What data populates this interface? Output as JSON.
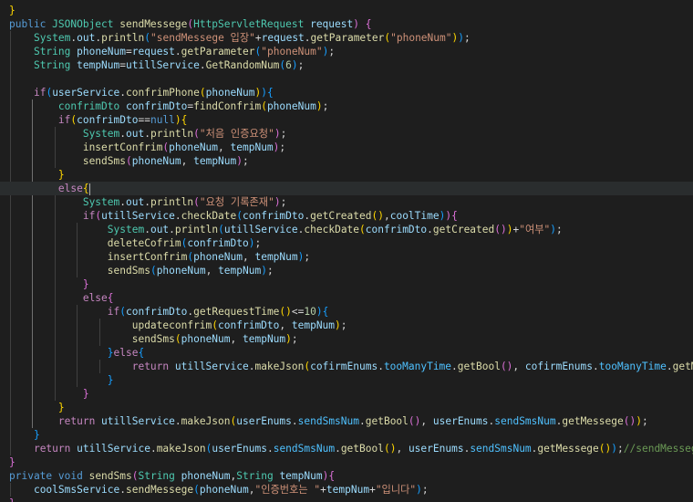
{
  "editor": {
    "language": "java",
    "theme": "dark",
    "current_line": 13,
    "lines": [
      [
        [
          "br1",
          "}"
        ]
      ],
      [
        [
          "kw",
          "public "
        ],
        [
          "typ",
          "JSONObject "
        ],
        [
          "fn",
          "sendMessege"
        ],
        [
          "br2",
          "("
        ],
        [
          "typ",
          "HttpServletRequest "
        ],
        [
          "var",
          "request"
        ],
        [
          "br2",
          ")"
        ],
        [
          "pun",
          " "
        ],
        [
          "br2",
          "{"
        ]
      ],
      [
        [
          "pun",
          "    "
        ],
        [
          "typ",
          "System"
        ],
        [
          "pun",
          "."
        ],
        [
          "var",
          "out"
        ],
        [
          "pun",
          "."
        ],
        [
          "fn",
          "println"
        ],
        [
          "br3",
          "("
        ],
        [
          "str",
          "\"sendMessege 입장\""
        ],
        [
          "pun",
          "+"
        ],
        [
          "var",
          "request"
        ],
        [
          "pun",
          "."
        ],
        [
          "fn",
          "getParameter"
        ],
        [
          "br1",
          "("
        ],
        [
          "str",
          "\"phoneNum\""
        ],
        [
          "br1",
          ")"
        ],
        [
          "br3",
          ")"
        ],
        [
          "pun",
          ";"
        ]
      ],
      [
        [
          "pun",
          "    "
        ],
        [
          "typ",
          "String "
        ],
        [
          "var",
          "phoneNum"
        ],
        [
          "pun",
          "="
        ],
        [
          "var",
          "request"
        ],
        [
          "pun",
          "."
        ],
        [
          "fn",
          "getParameter"
        ],
        [
          "br3",
          "("
        ],
        [
          "str",
          "\"phoneNum\""
        ],
        [
          "br3",
          ")"
        ],
        [
          "pun",
          ";"
        ]
      ],
      [
        [
          "pun",
          "    "
        ],
        [
          "typ",
          "String "
        ],
        [
          "var",
          "tempNum"
        ],
        [
          "pun",
          "="
        ],
        [
          "var",
          "utillService"
        ],
        [
          "pun",
          "."
        ],
        [
          "fn",
          "GetRandomNum"
        ],
        [
          "br3",
          "("
        ],
        [
          "num",
          "6"
        ],
        [
          "br3",
          ")"
        ],
        [
          "pun",
          ";"
        ]
      ],
      [],
      [
        [
          "pun",
          "    "
        ],
        [
          "ctl",
          "if"
        ],
        [
          "br3",
          "("
        ],
        [
          "var",
          "userService"
        ],
        [
          "pun",
          "."
        ],
        [
          "fn",
          "confrimPhone"
        ],
        [
          "br1",
          "("
        ],
        [
          "var",
          "phoneNum"
        ],
        [
          "br1",
          ")"
        ],
        [
          "br3",
          ")"
        ],
        [
          "br3",
          "{"
        ]
      ],
      [
        [
          "pun",
          "        "
        ],
        [
          "typ",
          "confrimDto "
        ],
        [
          "var",
          "confrimDto"
        ],
        [
          "pun",
          "="
        ],
        [
          "fn",
          "findConfrim"
        ],
        [
          "br1",
          "("
        ],
        [
          "var",
          "phoneNum"
        ],
        [
          "br1",
          ")"
        ],
        [
          "pun",
          ";"
        ]
      ],
      [
        [
          "pun",
          "        "
        ],
        [
          "ctl",
          "if"
        ],
        [
          "br1",
          "("
        ],
        [
          "var",
          "confrimDto"
        ],
        [
          "pun",
          "=="
        ],
        [
          "kw",
          "null"
        ],
        [
          "br1",
          ")"
        ],
        [
          "br1",
          "{"
        ]
      ],
      [
        [
          "pun",
          "            "
        ],
        [
          "typ",
          "System"
        ],
        [
          "pun",
          "."
        ],
        [
          "var",
          "out"
        ],
        [
          "pun",
          "."
        ],
        [
          "fn",
          "println"
        ],
        [
          "br2",
          "("
        ],
        [
          "str",
          "\"처음 인증요청\""
        ],
        [
          "br2",
          ")"
        ],
        [
          "pun",
          ";"
        ]
      ],
      [
        [
          "pun",
          "            "
        ],
        [
          "fn",
          "insertConfrim"
        ],
        [
          "br2",
          "("
        ],
        [
          "var",
          "phoneNum"
        ],
        [
          "pun",
          ", "
        ],
        [
          "var",
          "tempNum"
        ],
        [
          "br2",
          ")"
        ],
        [
          "pun",
          ";"
        ]
      ],
      [
        [
          "pun",
          "            "
        ],
        [
          "fn",
          "sendSms"
        ],
        [
          "br2",
          "("
        ],
        [
          "var",
          "phoneNum"
        ],
        [
          "pun",
          ", "
        ],
        [
          "var",
          "tempNum"
        ],
        [
          "br2",
          ")"
        ],
        [
          "pun",
          ";"
        ]
      ],
      [
        [
          "pun",
          "        "
        ],
        [
          "br1",
          "}"
        ]
      ],
      [
        [
          "pun",
          "        "
        ],
        [
          "ctl",
          "else"
        ],
        [
          "br1",
          "{"
        ]
      ],
      [
        [
          "pun",
          "            "
        ],
        [
          "typ",
          "System"
        ],
        [
          "pun",
          "."
        ],
        [
          "var",
          "out"
        ],
        [
          "pun",
          "."
        ],
        [
          "fn",
          "println"
        ],
        [
          "br2",
          "("
        ],
        [
          "str",
          "\"요청 기록존재\""
        ],
        [
          "br2",
          ")"
        ],
        [
          "pun",
          ";"
        ]
      ],
      [
        [
          "pun",
          "            "
        ],
        [
          "ctl",
          "if"
        ],
        [
          "br2",
          "("
        ],
        [
          "var",
          "utillService"
        ],
        [
          "pun",
          "."
        ],
        [
          "fn",
          "checkDate"
        ],
        [
          "br3",
          "("
        ],
        [
          "var",
          "confrimDto"
        ],
        [
          "pun",
          "."
        ],
        [
          "fn",
          "getCreated"
        ],
        [
          "br1",
          "()"
        ],
        [
          "pun",
          ","
        ],
        [
          "var",
          "coolTime"
        ],
        [
          "br3",
          ")"
        ],
        [
          "br2",
          ")"
        ],
        [
          "br2",
          "{"
        ]
      ],
      [
        [
          "pun",
          "                "
        ],
        [
          "typ",
          "System"
        ],
        [
          "pun",
          "."
        ],
        [
          "var",
          "out"
        ],
        [
          "pun",
          "."
        ],
        [
          "fn",
          "println"
        ],
        [
          "br3",
          "("
        ],
        [
          "var",
          "utillService"
        ],
        [
          "pun",
          "."
        ],
        [
          "fn",
          "checkDate"
        ],
        [
          "br1",
          "("
        ],
        [
          "var",
          "confrimDto"
        ],
        [
          "pun",
          "."
        ],
        [
          "fn",
          "getCreated"
        ],
        [
          "br2",
          "()"
        ],
        [
          "br1",
          ")"
        ],
        [
          "pun",
          "+"
        ],
        [
          "str",
          "\"여부\""
        ],
        [
          "br3",
          ")"
        ],
        [
          "pun",
          ";"
        ]
      ],
      [
        [
          "pun",
          "                "
        ],
        [
          "fn",
          "deleteCofrim"
        ],
        [
          "br3",
          "("
        ],
        [
          "var",
          "confrimDto"
        ],
        [
          "br3",
          ")"
        ],
        [
          "pun",
          ";"
        ]
      ],
      [
        [
          "pun",
          "                "
        ],
        [
          "fn",
          "insertConfrim"
        ],
        [
          "br3",
          "("
        ],
        [
          "var",
          "phoneNum"
        ],
        [
          "pun",
          ", "
        ],
        [
          "var",
          "tempNum"
        ],
        [
          "br3",
          ")"
        ],
        [
          "pun",
          ";"
        ]
      ],
      [
        [
          "pun",
          "                "
        ],
        [
          "fn",
          "sendSms"
        ],
        [
          "br3",
          "("
        ],
        [
          "var",
          "phoneNum"
        ],
        [
          "pun",
          ", "
        ],
        [
          "var",
          "tempNum"
        ],
        [
          "br3",
          ")"
        ],
        [
          "pun",
          ";"
        ]
      ],
      [
        [
          "pun",
          "            "
        ],
        [
          "br2",
          "}"
        ]
      ],
      [
        [
          "pun",
          "            "
        ],
        [
          "ctl",
          "else"
        ],
        [
          "br2",
          "{"
        ]
      ],
      [
        [
          "pun",
          "                "
        ],
        [
          "ctl",
          "if"
        ],
        [
          "br3",
          "("
        ],
        [
          "var",
          "confrimDto"
        ],
        [
          "pun",
          "."
        ],
        [
          "fn",
          "getRequestTime"
        ],
        [
          "br1",
          "()"
        ],
        [
          "pun",
          "<="
        ],
        [
          "num",
          "10"
        ],
        [
          "br3",
          ")"
        ],
        [
          "br3",
          "{"
        ]
      ],
      [
        [
          "pun",
          "                    "
        ],
        [
          "fn",
          "updateconfrim"
        ],
        [
          "br1",
          "("
        ],
        [
          "var",
          "confrimDto"
        ],
        [
          "pun",
          ", "
        ],
        [
          "var",
          "tempNum"
        ],
        [
          "br1",
          ")"
        ],
        [
          "pun",
          ";"
        ]
      ],
      [
        [
          "pun",
          "                    "
        ],
        [
          "fn",
          "sendSms"
        ],
        [
          "br1",
          "("
        ],
        [
          "var",
          "phoneNum"
        ],
        [
          "pun",
          ", "
        ],
        [
          "var",
          "tempNum"
        ],
        [
          "br1",
          ")"
        ],
        [
          "pun",
          ";"
        ]
      ],
      [
        [
          "pun",
          "                "
        ],
        [
          "br3",
          "}"
        ],
        [
          "ctl",
          "else"
        ],
        [
          "br3",
          "{"
        ]
      ],
      [
        [
          "pun",
          "                    "
        ],
        [
          "ctl",
          "return "
        ],
        [
          "var",
          "utillService"
        ],
        [
          "pun",
          "."
        ],
        [
          "fn",
          "makeJson"
        ],
        [
          "br1",
          "("
        ],
        [
          "var",
          "cofirmEnums"
        ],
        [
          "pun",
          "."
        ],
        [
          "con",
          "tooManyTime"
        ],
        [
          "pun",
          "."
        ],
        [
          "fn",
          "getBool"
        ],
        [
          "br2",
          "()"
        ],
        [
          "pun",
          ", "
        ],
        [
          "var",
          "cofirmEnums"
        ],
        [
          "pun",
          "."
        ],
        [
          "con",
          "tooManyTime"
        ],
        [
          "pun",
          "."
        ],
        [
          "fn",
          "getMessege"
        ],
        [
          "br2",
          "()"
        ],
        [
          "br1",
          ")"
        ],
        [
          "pun",
          ";"
        ]
      ],
      [
        [
          "pun",
          "                "
        ],
        [
          "br3",
          "}"
        ]
      ],
      [
        [
          "pun",
          "            "
        ],
        [
          "br2",
          "}"
        ]
      ],
      [
        [
          "pun",
          "        "
        ],
        [
          "br1",
          "}"
        ]
      ],
      [
        [
          "pun",
          "        "
        ],
        [
          "ctl",
          "return "
        ],
        [
          "var",
          "utillService"
        ],
        [
          "pun",
          "."
        ],
        [
          "fn",
          "makeJson"
        ],
        [
          "br1",
          "("
        ],
        [
          "var",
          "userEnums"
        ],
        [
          "pun",
          "."
        ],
        [
          "con",
          "sendSmsNum"
        ],
        [
          "pun",
          "."
        ],
        [
          "fn",
          "getBool"
        ],
        [
          "br2",
          "()"
        ],
        [
          "pun",
          ", "
        ],
        [
          "var",
          "userEnums"
        ],
        [
          "pun",
          "."
        ],
        [
          "con",
          "sendSmsNum"
        ],
        [
          "pun",
          "."
        ],
        [
          "fn",
          "getMessege"
        ],
        [
          "br2",
          "()"
        ],
        [
          "br1",
          ")"
        ],
        [
          "pun",
          ";"
        ]
      ],
      [
        [
          "pun",
          "    "
        ],
        [
          "br3",
          "}"
        ]
      ],
      [
        [
          "pun",
          "    "
        ],
        [
          "ctl",
          "return "
        ],
        [
          "var",
          "utillService"
        ],
        [
          "pun",
          "."
        ],
        [
          "fn",
          "makeJson"
        ],
        [
          "br3",
          "("
        ],
        [
          "var",
          "userEnums"
        ],
        [
          "pun",
          "."
        ],
        [
          "con",
          "sendSmsNum"
        ],
        [
          "pun",
          "."
        ],
        [
          "fn",
          "getBool"
        ],
        [
          "br1",
          "()"
        ],
        [
          "pun",
          ", "
        ],
        [
          "var",
          "userEnums"
        ],
        [
          "pun",
          "."
        ],
        [
          "con",
          "sendSmsNum"
        ],
        [
          "pun",
          "."
        ],
        [
          "fn",
          "getMessege"
        ],
        [
          "br1",
          "()"
        ],
        [
          "br3",
          ")"
        ],
        [
          "pun",
          ";"
        ],
        [
          "cmt",
          "//sendMessege(coolSmsDto"
        ]
      ],
      [
        [
          "br2",
          "}"
        ]
      ],
      [
        [
          "kw",
          "private "
        ],
        [
          "kw",
          "void "
        ],
        [
          "fn",
          "sendSms"
        ],
        [
          "br2",
          "("
        ],
        [
          "typ",
          "String "
        ],
        [
          "var",
          "phoneNum"
        ],
        [
          "pun",
          ","
        ],
        [
          "typ",
          "String "
        ],
        [
          "var",
          "tempNum"
        ],
        [
          "br2",
          ")"
        ],
        [
          "br2",
          "{"
        ]
      ],
      [
        [
          "pun",
          "    "
        ],
        [
          "var",
          "coolSmsService"
        ],
        [
          "pun",
          "."
        ],
        [
          "fn",
          "sendMessege"
        ],
        [
          "br3",
          "("
        ],
        [
          "var",
          "phoneNum"
        ],
        [
          "pun",
          ","
        ],
        [
          "str",
          "\"인증번호는 \""
        ],
        [
          "pun",
          "+"
        ],
        [
          "var",
          "tempNum"
        ],
        [
          "pun",
          "+"
        ],
        [
          "str",
          "\"입니다\""
        ],
        [
          "br3",
          ")"
        ],
        [
          "pun",
          ";"
        ]
      ],
      [
        [
          "br2",
          "}"
        ]
      ]
    ]
  }
}
